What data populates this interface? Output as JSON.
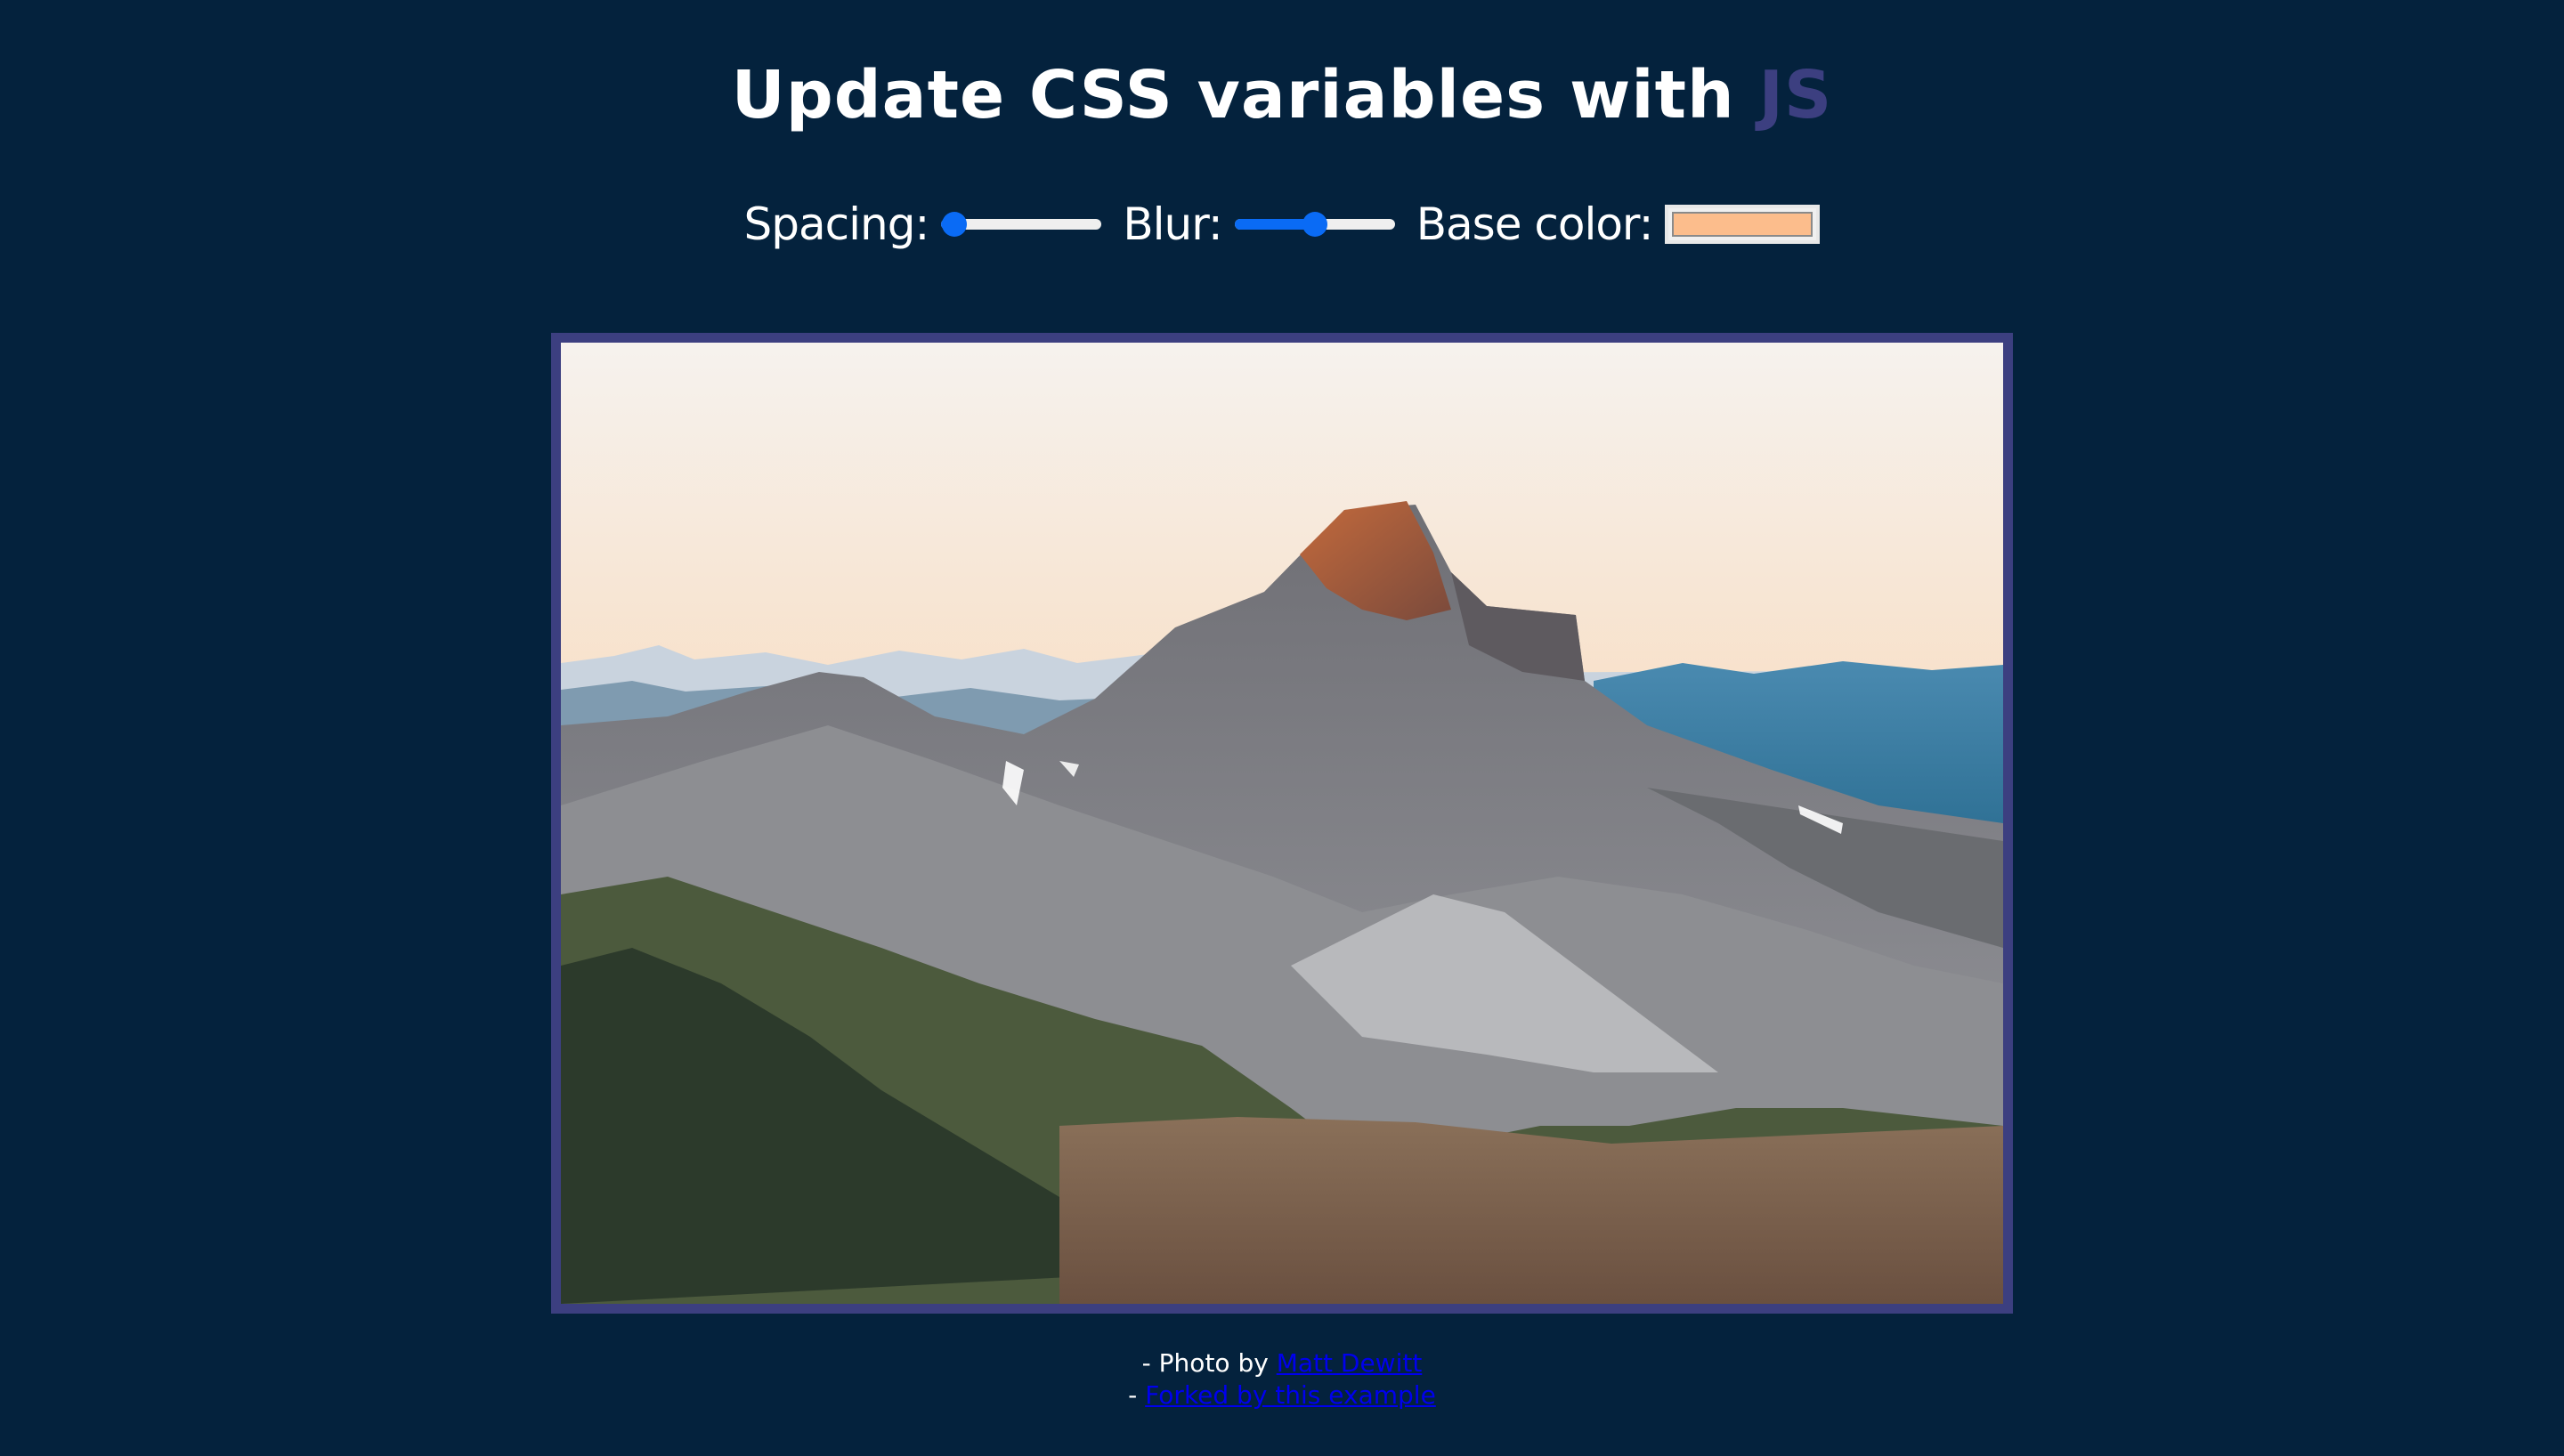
{
  "header": {
    "title_main": "Update CSS variables with ",
    "title_highlight": "JS"
  },
  "controls": {
    "spacing": {
      "label": "Spacing:",
      "value_fraction": 0.08
    },
    "blur": {
      "label": "Blur:",
      "value_fraction": 0.5
    },
    "base_color": {
      "label": "Base color:",
      "value": "#ffc600"
    }
  },
  "colors": {
    "background": "#04223d",
    "accent": "#3c3f80",
    "slider": "#0a6bf5",
    "swatch": "#fcbd8c"
  },
  "image": {
    "subject": "mountain-landscape-photo"
  },
  "credits": {
    "line1_prefix": "- Photo by ",
    "photographer_link": "Matt Dewitt",
    "line2_prefix": "- ",
    "source_link": "Forked by this example"
  }
}
